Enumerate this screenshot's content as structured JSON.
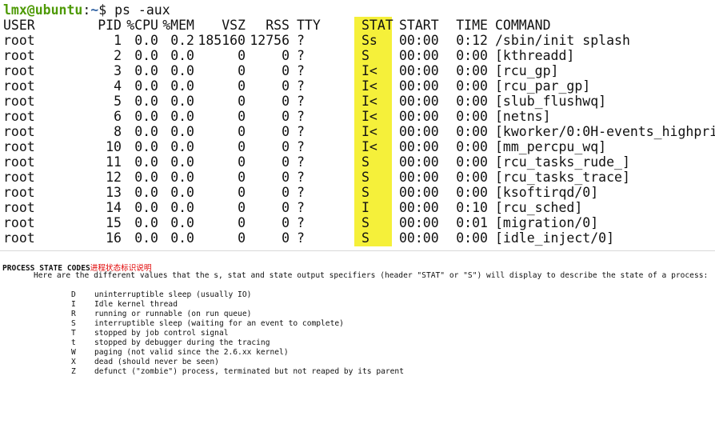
{
  "terminal": {
    "prompt": {
      "user_host": "lmx@ubuntu",
      "sep": ":",
      "path": "~",
      "symbol": "$ ",
      "command": "ps -aux"
    },
    "headers": {
      "user": "USER",
      "pid": "PID",
      "cpu": "%CPU",
      "mem": "%MEM",
      "vsz": "VSZ",
      "rss": "RSS",
      "tty": "TTY",
      "stat": "STAT",
      "start": "START",
      "time": "TIME",
      "command": "COMMAND"
    },
    "rows": [
      {
        "user": "root",
        "pid": "1",
        "cpu": "0.0",
        "mem": "0.2",
        "vsz": "185160",
        "rss": "12756",
        "tty": "?",
        "stat": "Ss",
        "start": "00:00",
        "time": "0:12",
        "command": "/sbin/init splash"
      },
      {
        "user": "root",
        "pid": "2",
        "cpu": "0.0",
        "mem": "0.0",
        "vsz": "0",
        "rss": "0",
        "tty": "?",
        "stat": "S",
        "start": "00:00",
        "time": "0:00",
        "command": "[kthreadd]"
      },
      {
        "user": "root",
        "pid": "3",
        "cpu": "0.0",
        "mem": "0.0",
        "vsz": "0",
        "rss": "0",
        "tty": "?",
        "stat": "I<",
        "start": "00:00",
        "time": "0:00",
        "command": "[rcu_gp]"
      },
      {
        "user": "root",
        "pid": "4",
        "cpu": "0.0",
        "mem": "0.0",
        "vsz": "0",
        "rss": "0",
        "tty": "?",
        "stat": "I<",
        "start": "00:00",
        "time": "0:00",
        "command": "[rcu_par_gp]"
      },
      {
        "user": "root",
        "pid": "5",
        "cpu": "0.0",
        "mem": "0.0",
        "vsz": "0",
        "rss": "0",
        "tty": "?",
        "stat": "I<",
        "start": "00:00",
        "time": "0:00",
        "command": "[slub_flushwq]"
      },
      {
        "user": "root",
        "pid": "6",
        "cpu": "0.0",
        "mem": "0.0",
        "vsz": "0",
        "rss": "0",
        "tty": "?",
        "stat": "I<",
        "start": "00:00",
        "time": "0:00",
        "command": "[netns]"
      },
      {
        "user": "root",
        "pid": "8",
        "cpu": "0.0",
        "mem": "0.0",
        "vsz": "0",
        "rss": "0",
        "tty": "?",
        "stat": "I<",
        "start": "00:00",
        "time": "0:00",
        "command": "[kworker/0:0H-events_highpri]"
      },
      {
        "user": "root",
        "pid": "10",
        "cpu": "0.0",
        "mem": "0.0",
        "vsz": "0",
        "rss": "0",
        "tty": "?",
        "stat": "I<",
        "start": "00:00",
        "time": "0:00",
        "command": "[mm_percpu_wq]"
      },
      {
        "user": "root",
        "pid": "11",
        "cpu": "0.0",
        "mem": "0.0",
        "vsz": "0",
        "rss": "0",
        "tty": "?",
        "stat": "S",
        "start": "00:00",
        "time": "0:00",
        "command": "[rcu_tasks_rude_]"
      },
      {
        "user": "root",
        "pid": "12",
        "cpu": "0.0",
        "mem": "0.0",
        "vsz": "0",
        "rss": "0",
        "tty": "?",
        "stat": "S",
        "start": "00:00",
        "time": "0:00",
        "command": "[rcu_tasks_trace]"
      },
      {
        "user": "root",
        "pid": "13",
        "cpu": "0.0",
        "mem": "0.0",
        "vsz": "0",
        "rss": "0",
        "tty": "?",
        "stat": "S",
        "start": "00:00",
        "time": "0:00",
        "command": "[ksoftirqd/0]"
      },
      {
        "user": "root",
        "pid": "14",
        "cpu": "0.0",
        "mem": "0.0",
        "vsz": "0",
        "rss": "0",
        "tty": "?",
        "stat": "I",
        "start": "00:00",
        "time": "0:10",
        "command": "[rcu_sched]"
      },
      {
        "user": "root",
        "pid": "15",
        "cpu": "0.0",
        "mem": "0.0",
        "vsz": "0",
        "rss": "0",
        "tty": "?",
        "stat": "S",
        "start": "00:00",
        "time": "0:01",
        "command": "[migration/0]"
      },
      {
        "user": "root",
        "pid": "16",
        "cpu": "0.0",
        "mem": "0.0",
        "vsz": "0",
        "rss": "0",
        "tty": "?",
        "stat": "S",
        "start": "00:00",
        "time": "0:00",
        "command": "[idle_inject/0]"
      }
    ]
  },
  "manpage": {
    "title": "PROCESS STATE CODES",
    "title_cn": "进程状态标识说明",
    "description": "Here are the different values that the s, stat and state output specifiers (header \"STAT\" or \"S\") will display to describe the state of a process:",
    "codes": [
      {
        "code": "D",
        "desc": "uninterruptible sleep (usually IO)"
      },
      {
        "code": "I",
        "desc": "Idle kernel thread"
      },
      {
        "code": "R",
        "desc": "running or runnable (on run queue)"
      },
      {
        "code": "S",
        "desc": "interruptible sleep (waiting for an event to complete)"
      },
      {
        "code": "T",
        "desc": "stopped by job control signal"
      },
      {
        "code": "t",
        "desc": "stopped by debugger during the tracing"
      },
      {
        "code": "W",
        "desc": "paging (not valid since the 2.6.xx kernel)"
      },
      {
        "code": "X",
        "desc": "dead (should never be seen)"
      },
      {
        "code": "Z",
        "desc": "defunct (\"zombie\") process, terminated but not reaped by its parent"
      }
    ]
  },
  "colors": {
    "stat_highlight": "#f5f03a",
    "prompt_user": "#4e9a06",
    "prompt_path": "#3465a4",
    "cn_title": "#e00000"
  }
}
